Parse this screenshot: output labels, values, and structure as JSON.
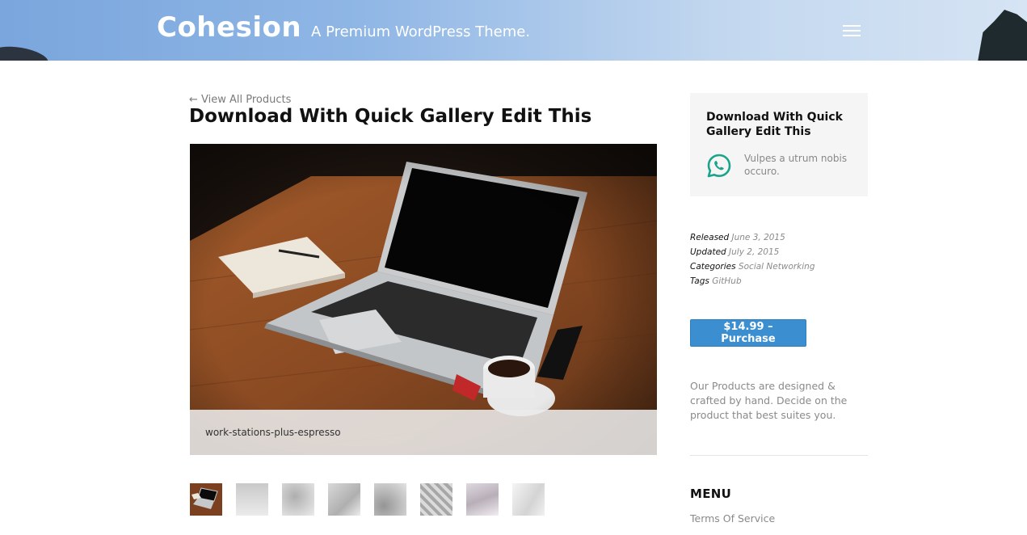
{
  "header": {
    "site_title": "Cohesion",
    "tagline": "A Premium WordPress Theme.",
    "colors": {
      "sky": "#8fb6e5",
      "text": "#ffffff"
    }
  },
  "main": {
    "back_link": "← View All Products",
    "product_title": "Download With Quick Gallery Edit This",
    "gallery": {
      "caption": "work-stations-plus-espresso",
      "thumbnail_count": 8
    }
  },
  "sidebar": {
    "promo": {
      "title": "Download With Quick Gallery Edit This",
      "icon": "whatsapp-icon",
      "text": "Vulpes a utrum nobis occuro."
    },
    "meta": [
      {
        "key": "Released",
        "value": "June 3, 2015"
      },
      {
        "key": "Updated",
        "value": "July 2, 2015"
      },
      {
        "key": "Categories",
        "value": "Social Networking"
      },
      {
        "key": "Tags",
        "value": "GitHub"
      }
    ],
    "purchase_button": "$14.99 – Purchase",
    "about": "Our Products are designed & crafted by hand. Decide on the product that best suites you.",
    "menu_heading": "MENU",
    "menu_items": [
      "Terms Of Service"
    ]
  },
  "colors": {
    "accent": "#3b8fd0",
    "whatsapp": "#1aa48a",
    "muted_text": "#8a8a8a"
  }
}
